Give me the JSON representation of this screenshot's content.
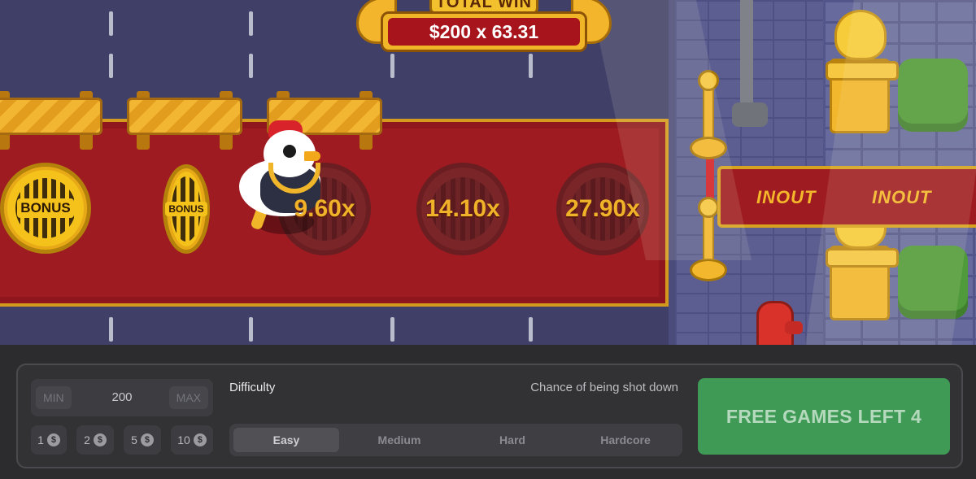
{
  "game": {
    "total_win_title": "TOTAL WIN",
    "total_win_value": "$200 x 63.31",
    "tiles": [
      {
        "kind": "bonus",
        "label": "BONUS"
      },
      {
        "kind": "bonus",
        "label": "BONUS"
      },
      {
        "kind": "multiplier",
        "label": "9.60x"
      },
      {
        "kind": "multiplier",
        "label": "14.10x"
      },
      {
        "kind": "multiplier",
        "label": "27.90x"
      }
    ],
    "sign_logo_1": "INOUT",
    "sign_logo_2": "INOUT",
    "colors": {
      "carpet": "#9e1b22",
      "gold": "#f4c21b",
      "road": "#3f3f68",
      "multiplier_text": "#f0b228"
    }
  },
  "controls": {
    "bet": {
      "min_label": "MIN",
      "value": "200",
      "max_label": "MAX"
    },
    "quick_bets": [
      {
        "amount": "1",
        "currency_icon": "dollar-icon"
      },
      {
        "amount": "2",
        "currency_icon": "dollar-icon"
      },
      {
        "amount": "5",
        "currency_icon": "dollar-icon"
      },
      {
        "amount": "10",
        "currency_icon": "dollar-icon"
      }
    ],
    "difficulty_label": "Difficulty",
    "chance_label": "Chance of being shot down",
    "difficulty_options": [
      "Easy",
      "Medium",
      "Hard",
      "Hardcore"
    ],
    "selected_difficulty": "Easy",
    "play_button_label": "FREE GAMES LEFT 4",
    "colors": {
      "panel": "#323235",
      "play_button": "#3f9a56"
    }
  }
}
